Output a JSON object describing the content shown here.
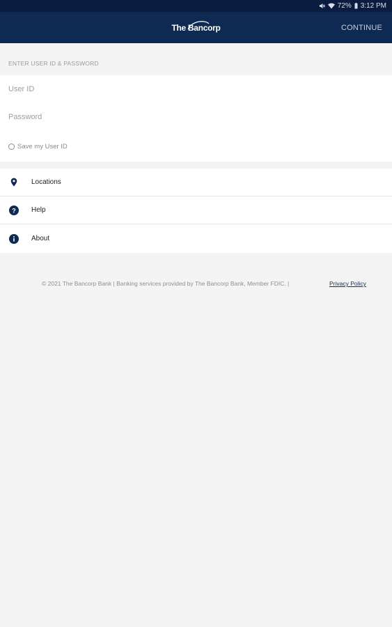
{
  "status_bar": {
    "mute_icon": "mute-icon",
    "wifi_icon": "wifi-icon",
    "battery_percent": "72%",
    "battery_icon": "battery-icon",
    "time": "3:12 PM"
  },
  "app_bar": {
    "logo_text": "The Bancorp",
    "continue_label": "CONTINUE"
  },
  "login": {
    "section_label": "ENTER USER ID & PASSWORD",
    "user_id_placeholder": "User ID",
    "password_placeholder": "Password",
    "save_label": "Save my User ID"
  },
  "menu": {
    "items": [
      {
        "label": "Locations",
        "icon": "location-pin-icon"
      },
      {
        "label": "Help",
        "icon": "help-icon"
      },
      {
        "label": "About",
        "icon": "info-icon"
      }
    ]
  },
  "footer": {
    "copyright": "© 2021 The Bancorp Bank | Banking services provided by The Bancorp Bank, Member FDIC. |",
    "privacy_label": "Privacy Policy"
  },
  "colors": {
    "status_bar": "#0a1c3f",
    "app_bar": "#0f2a52",
    "background": "#f4f4f4",
    "icon": "#0f2a52"
  }
}
